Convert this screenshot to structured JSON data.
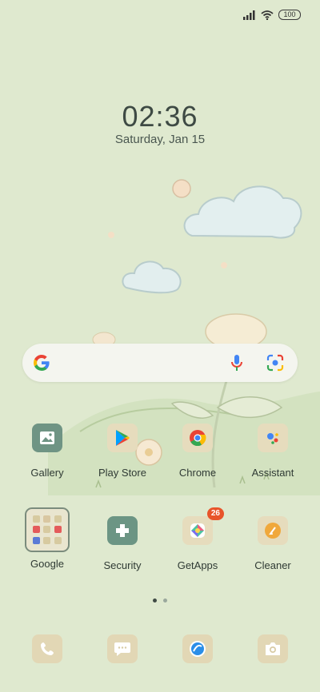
{
  "status": {
    "battery": "100",
    "icons": [
      "signal-icon",
      "wifi-icon",
      "battery-icon"
    ]
  },
  "clock": {
    "time": "02:36",
    "date": "Saturday, Jan 15"
  },
  "search": {
    "icons": [
      "google-g-icon",
      "microphone-icon",
      "lens-camera-icon"
    ]
  },
  "apps_row1": [
    {
      "label": "Gallery",
      "icon": "gallery-icon"
    },
    {
      "label": "Play Store",
      "icon": "play-store-icon"
    },
    {
      "label": "Chrome",
      "icon": "chrome-icon"
    },
    {
      "label": "Assistant",
      "icon": "assistant-icon"
    }
  ],
  "apps_row2": [
    {
      "label": "Google",
      "icon": "folder-icon"
    },
    {
      "label": "Security",
      "icon": "security-icon"
    },
    {
      "label": "GetApps",
      "icon": "getapps-icon",
      "badge": "26"
    },
    {
      "label": "Cleaner",
      "icon": "cleaner-icon"
    }
  ],
  "pages": {
    "count": 2,
    "active": 0
  },
  "dock": [
    {
      "icon": "phone-icon"
    },
    {
      "icon": "messages-icon"
    },
    {
      "icon": "browser-icon"
    },
    {
      "icon": "camera-icon"
    }
  ],
  "colors": {
    "accent": "#e8542a",
    "background": "#dfe9cf",
    "text": "#3e4a44"
  }
}
